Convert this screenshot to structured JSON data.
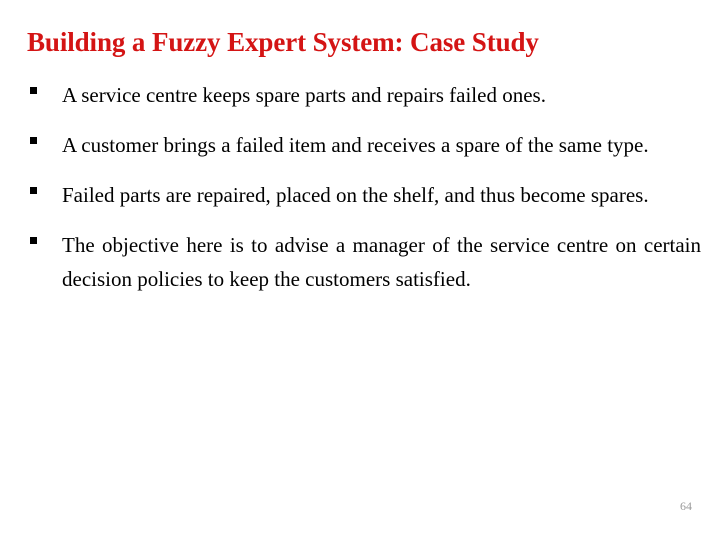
{
  "slide": {
    "title": "Building a Fuzzy Expert System: Case Study",
    "title_color": "#d41414",
    "background_color": "#ffffff",
    "page_number": "64",
    "page_number_color": "#9a9a9a",
    "bullet_icon": "square-bullet",
    "bullets": [
      {
        "text": "A service centre keeps spare parts and repairs failed ones."
      },
      {
        "text": "A customer brings a failed item and receives a spare of the same type."
      },
      {
        "text": "Failed parts are repaired, placed on the shelf, and thus become spares."
      },
      {
        "text": "The objective here is to advise a manager of the service centre on certain decision policies to keep  the customers satisfied."
      }
    ]
  }
}
